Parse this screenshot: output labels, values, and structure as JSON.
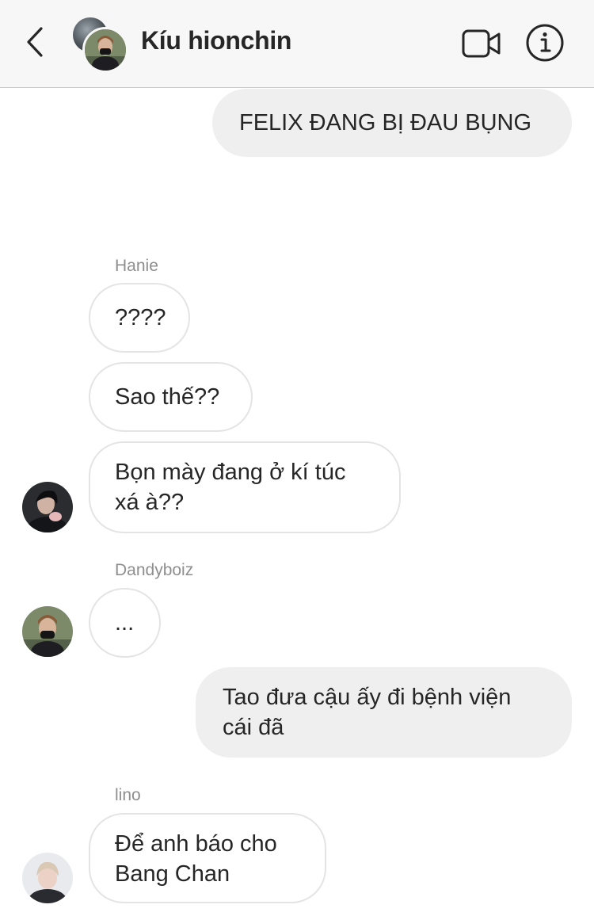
{
  "header": {
    "title": "Kíu hionchin"
  },
  "messages": {
    "m1": {
      "text": "FELIX ĐANG BỊ ĐAU BỤNG"
    },
    "hanie": {
      "sender": "Hanie",
      "m2": "????",
      "m3": "Sao thế??",
      "m4_line1": "Bọn mày đang ở kí túc",
      "m4_line2": "xá à??"
    },
    "dandy": {
      "sender": "Dandyboiz",
      "m5": "..."
    },
    "m6_line1": "Tao đưa cậu ấy đi bệnh viện",
    "m6_line2": "cái đã",
    "lino": {
      "sender": "lino",
      "m7_line1": "Để anh báo cho",
      "m7_line2": "Bang Chan"
    }
  },
  "icons": {
    "back": "chevron-left-icon",
    "video": "video-camera-icon",
    "info": "info-circle-icon"
  }
}
